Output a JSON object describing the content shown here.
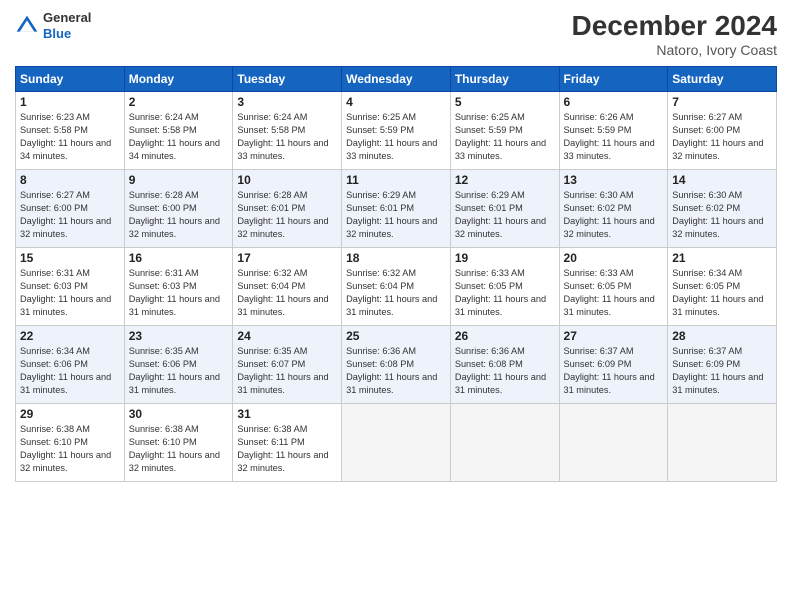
{
  "header": {
    "logo_line1": "General",
    "logo_line2": "Blue",
    "month": "December 2024",
    "location": "Natoro, Ivory Coast"
  },
  "weekdays": [
    "Sunday",
    "Monday",
    "Tuesday",
    "Wednesday",
    "Thursday",
    "Friday",
    "Saturday"
  ],
  "weeks": [
    [
      {
        "day": 1,
        "sunrise": "6:23 AM",
        "sunset": "5:58 PM",
        "daylight": "11 hours and 34 minutes."
      },
      {
        "day": 2,
        "sunrise": "6:24 AM",
        "sunset": "5:58 PM",
        "daylight": "11 hours and 34 minutes."
      },
      {
        "day": 3,
        "sunrise": "6:24 AM",
        "sunset": "5:58 PM",
        "daylight": "11 hours and 33 minutes."
      },
      {
        "day": 4,
        "sunrise": "6:25 AM",
        "sunset": "5:59 PM",
        "daylight": "11 hours and 33 minutes."
      },
      {
        "day": 5,
        "sunrise": "6:25 AM",
        "sunset": "5:59 PM",
        "daylight": "11 hours and 33 minutes."
      },
      {
        "day": 6,
        "sunrise": "6:26 AM",
        "sunset": "5:59 PM",
        "daylight": "11 hours and 33 minutes."
      },
      {
        "day": 7,
        "sunrise": "6:27 AM",
        "sunset": "6:00 PM",
        "daylight": "11 hours and 32 minutes."
      }
    ],
    [
      {
        "day": 8,
        "sunrise": "6:27 AM",
        "sunset": "6:00 PM",
        "daylight": "11 hours and 32 minutes."
      },
      {
        "day": 9,
        "sunrise": "6:28 AM",
        "sunset": "6:00 PM",
        "daylight": "11 hours and 32 minutes."
      },
      {
        "day": 10,
        "sunrise": "6:28 AM",
        "sunset": "6:01 PM",
        "daylight": "11 hours and 32 minutes."
      },
      {
        "day": 11,
        "sunrise": "6:29 AM",
        "sunset": "6:01 PM",
        "daylight": "11 hours and 32 minutes."
      },
      {
        "day": 12,
        "sunrise": "6:29 AM",
        "sunset": "6:01 PM",
        "daylight": "11 hours and 32 minutes."
      },
      {
        "day": 13,
        "sunrise": "6:30 AM",
        "sunset": "6:02 PM",
        "daylight": "11 hours and 32 minutes."
      },
      {
        "day": 14,
        "sunrise": "6:30 AM",
        "sunset": "6:02 PM",
        "daylight": "11 hours and 32 minutes."
      }
    ],
    [
      {
        "day": 15,
        "sunrise": "6:31 AM",
        "sunset": "6:03 PM",
        "daylight": "11 hours and 31 minutes."
      },
      {
        "day": 16,
        "sunrise": "6:31 AM",
        "sunset": "6:03 PM",
        "daylight": "11 hours and 31 minutes."
      },
      {
        "day": 17,
        "sunrise": "6:32 AM",
        "sunset": "6:04 PM",
        "daylight": "11 hours and 31 minutes."
      },
      {
        "day": 18,
        "sunrise": "6:32 AM",
        "sunset": "6:04 PM",
        "daylight": "11 hours and 31 minutes."
      },
      {
        "day": 19,
        "sunrise": "6:33 AM",
        "sunset": "6:05 PM",
        "daylight": "11 hours and 31 minutes."
      },
      {
        "day": 20,
        "sunrise": "6:33 AM",
        "sunset": "6:05 PM",
        "daylight": "11 hours and 31 minutes."
      },
      {
        "day": 21,
        "sunrise": "6:34 AM",
        "sunset": "6:05 PM",
        "daylight": "11 hours and 31 minutes."
      }
    ],
    [
      {
        "day": 22,
        "sunrise": "6:34 AM",
        "sunset": "6:06 PM",
        "daylight": "11 hours and 31 minutes."
      },
      {
        "day": 23,
        "sunrise": "6:35 AM",
        "sunset": "6:06 PM",
        "daylight": "11 hours and 31 minutes."
      },
      {
        "day": 24,
        "sunrise": "6:35 AM",
        "sunset": "6:07 PM",
        "daylight": "11 hours and 31 minutes."
      },
      {
        "day": 25,
        "sunrise": "6:36 AM",
        "sunset": "6:08 PM",
        "daylight": "11 hours and 31 minutes."
      },
      {
        "day": 26,
        "sunrise": "6:36 AM",
        "sunset": "6:08 PM",
        "daylight": "11 hours and 31 minutes."
      },
      {
        "day": 27,
        "sunrise": "6:37 AM",
        "sunset": "6:09 PM",
        "daylight": "11 hours and 31 minutes."
      },
      {
        "day": 28,
        "sunrise": "6:37 AM",
        "sunset": "6:09 PM",
        "daylight": "11 hours and 31 minutes."
      }
    ],
    [
      {
        "day": 29,
        "sunrise": "6:38 AM",
        "sunset": "6:10 PM",
        "daylight": "11 hours and 32 minutes."
      },
      {
        "day": 30,
        "sunrise": "6:38 AM",
        "sunset": "6:10 PM",
        "daylight": "11 hours and 32 minutes."
      },
      {
        "day": 31,
        "sunrise": "6:38 AM",
        "sunset": "6:11 PM",
        "daylight": "11 hours and 32 minutes."
      },
      null,
      null,
      null,
      null
    ]
  ]
}
